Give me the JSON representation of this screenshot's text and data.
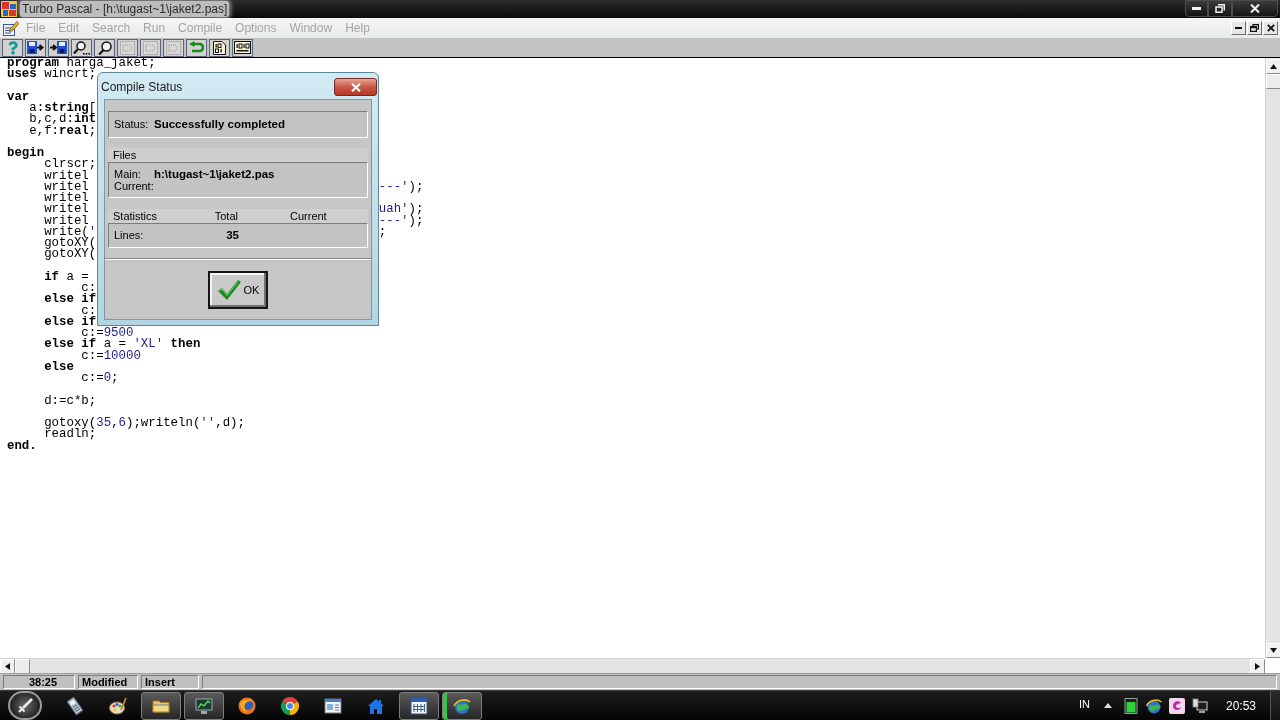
{
  "window": {
    "title": "Turbo Pascal - [h:\\tugast~1\\jaket2.pas]"
  },
  "menu": [
    {
      "label": "File",
      "disabled": true
    },
    {
      "label": "Edit",
      "disabled": true
    },
    {
      "label": "Search",
      "disabled": true
    },
    {
      "label": "Run",
      "disabled": true
    },
    {
      "label": "Compile",
      "disabled": true
    },
    {
      "label": "Options",
      "disabled": true
    },
    {
      "label": "Window",
      "disabled": true
    },
    {
      "label": "Help",
      "disabled": true
    }
  ],
  "editor": {
    "lines": [
      {
        "kind": "code",
        "tokens": [
          {
            "kind": "keyword",
            "text": "program"
          },
          {
            "kind": "plain",
            "text": " harga_jaket;"
          }
        ]
      },
      {
        "kind": "code",
        "tokens": [
          {
            "kind": "keyword",
            "text": "uses"
          },
          {
            "kind": "plain",
            "text": " wincrt;"
          }
        ]
      },
      {
        "kind": "blank"
      },
      {
        "kind": "code",
        "tokens": [
          {
            "kind": "keyword",
            "text": "var"
          }
        ]
      },
      {
        "kind": "code",
        "tokens": [
          {
            "kind": "plain",
            "text": "   a:"
          },
          {
            "kind": "keyword",
            "text": "string"
          },
          {
            "kind": "plain",
            "text": "["
          }
        ]
      },
      {
        "kind": "code",
        "tokens": [
          {
            "kind": "plain",
            "text": "   b,c,d:"
          },
          {
            "kind": "keyword",
            "text": "int"
          }
        ]
      },
      {
        "kind": "code",
        "tokens": [
          {
            "kind": "plain",
            "text": "   e,f:"
          },
          {
            "kind": "keyword",
            "text": "real"
          },
          {
            "kind": "plain",
            "text": ";"
          }
        ]
      },
      {
        "kind": "blank"
      },
      {
        "kind": "code",
        "tokens": [
          {
            "kind": "keyword",
            "text": "begin"
          }
        ]
      },
      {
        "kind": "code",
        "tokens": [
          {
            "kind": "plain",
            "text": "     clrscr;"
          }
        ]
      },
      {
        "kind": "code",
        "tokens": [
          {
            "kind": "plain",
            "text": "     writel"
          }
        ]
      },
      {
        "kind": "code",
        "tokens": [
          {
            "kind": "plain",
            "text": "     writel"
          }
        ],
        "tail": [
          {
            "kind": "literal",
            "text": "---'"
          },
          {
            "kind": "plain",
            "text": ");"
          }
        ]
      },
      {
        "kind": "code",
        "tokens": [
          {
            "kind": "plain",
            "text": "     writel"
          }
        ]
      },
      {
        "kind": "code",
        "tokens": [
          {
            "kind": "plain",
            "text": "     writel"
          }
        ],
        "tail": [
          {
            "kind": "literal",
            "text": "uah'"
          },
          {
            "kind": "plain",
            "text": ");"
          }
        ]
      },
      {
        "kind": "code",
        "tokens": [
          {
            "kind": "plain",
            "text": "     writel"
          }
        ],
        "tail": [
          {
            "kind": "literal",
            "text": "---'"
          },
          {
            "kind": "plain",
            "text": ");"
          }
        ]
      },
      {
        "kind": "code",
        "tokens": [
          {
            "kind": "plain",
            "text": "     write("
          },
          {
            "kind": "literal",
            "text": "'"
          }
        ],
        "tail": [
          {
            "kind": "plain",
            "text": ";"
          }
        ]
      },
      {
        "kind": "code",
        "tokens": [
          {
            "kind": "plain",
            "text": "     gotoXY("
          }
        ]
      },
      {
        "kind": "code",
        "tokens": [
          {
            "kind": "plain",
            "text": "     gotoXY("
          }
        ]
      },
      {
        "kind": "blank"
      },
      {
        "kind": "code",
        "tokens": [
          {
            "kind": "keyword",
            "text": "     if"
          },
          {
            "kind": "plain",
            "text": " a ="
          }
        ]
      },
      {
        "kind": "code",
        "tokens": [
          {
            "kind": "plain",
            "text": "          c:"
          }
        ]
      },
      {
        "kind": "code",
        "tokens": [
          {
            "kind": "keyword",
            "text": "     else if"
          }
        ]
      },
      {
        "kind": "code",
        "tokens": [
          {
            "kind": "plain",
            "text": "          c:"
          }
        ]
      },
      {
        "kind": "code",
        "tokens": [
          {
            "kind": "keyword",
            "text": "     else if"
          }
        ]
      },
      {
        "kind": "code",
        "tokens": [
          {
            "kind": "plain",
            "text": "          c:="
          },
          {
            "kind": "literal",
            "text": "9500"
          }
        ]
      },
      {
        "kind": "code",
        "tokens": [
          {
            "kind": "keyword",
            "text": "     else if"
          },
          {
            "kind": "plain",
            "text": " a = "
          },
          {
            "kind": "literal",
            "text": "'XL'"
          },
          {
            "kind": "keyword",
            "text": " then"
          }
        ]
      },
      {
        "kind": "code",
        "tokens": [
          {
            "kind": "plain",
            "text": "          c:="
          },
          {
            "kind": "literal",
            "text": "10000"
          }
        ]
      },
      {
        "kind": "code",
        "tokens": [
          {
            "kind": "keyword",
            "text": "     else"
          }
        ]
      },
      {
        "kind": "code",
        "tokens": [
          {
            "kind": "plain",
            "text": "          c:="
          },
          {
            "kind": "literal",
            "text": "0"
          },
          {
            "kind": "plain",
            "text": ";"
          }
        ]
      },
      {
        "kind": "blank"
      },
      {
        "kind": "code",
        "tokens": [
          {
            "kind": "plain",
            "text": "     d:=c*b;"
          }
        ]
      },
      {
        "kind": "blank"
      },
      {
        "kind": "code",
        "tokens": [
          {
            "kind": "plain",
            "text": "     gotoxy("
          },
          {
            "kind": "literal",
            "text": "35"
          },
          {
            "kind": "plain",
            "text": ","
          },
          {
            "kind": "literal",
            "text": "6"
          },
          {
            "kind": "plain",
            "text": ");writeln("
          },
          {
            "kind": "literal",
            "text": "''"
          },
          {
            "kind": "plain",
            "text": ",d);"
          }
        ]
      },
      {
        "kind": "code",
        "tokens": [
          {
            "kind": "plain",
            "text": "     readln;"
          }
        ]
      },
      {
        "kind": "code",
        "tokens": [
          {
            "kind": "keyword",
            "text": "end."
          }
        ]
      }
    ]
  },
  "dialog": {
    "title": "Compile Status",
    "status": {
      "label": "Status:",
      "value": "Successfully completed"
    },
    "files": {
      "heading": "Files",
      "rows": [
        {
          "label": "Main:",
          "value": "h:\\tugast~1\\jaket2.pas"
        },
        {
          "label": "Current:"
        }
      ]
    },
    "statistics": {
      "heading": "Statistics",
      "columns": [
        "Total",
        "Current"
      ],
      "rows": [
        {
          "label": "Lines:",
          "total": "35"
        }
      ]
    },
    "button": "OK"
  },
  "status_bar": {
    "fields": [
      "38:25",
      "Modified",
      "Insert"
    ]
  },
  "taskbar": {
    "buttons": [
      {
        "open": false,
        "selected": false
      },
      {
        "open": false,
        "selected": false
      },
      {
        "open": true,
        "selected": false
      },
      {
        "open": true,
        "selected": false
      },
      {
        "open": false,
        "selected": false
      },
      {
        "open": false,
        "selected": false
      },
      {
        "open": false,
        "selected": false
      },
      {
        "open": false,
        "selected": false
      },
      {
        "open": true,
        "selected": false
      },
      {
        "open": true,
        "selected": true
      }
    ],
    "language": "IN",
    "clock": "20:53"
  }
}
